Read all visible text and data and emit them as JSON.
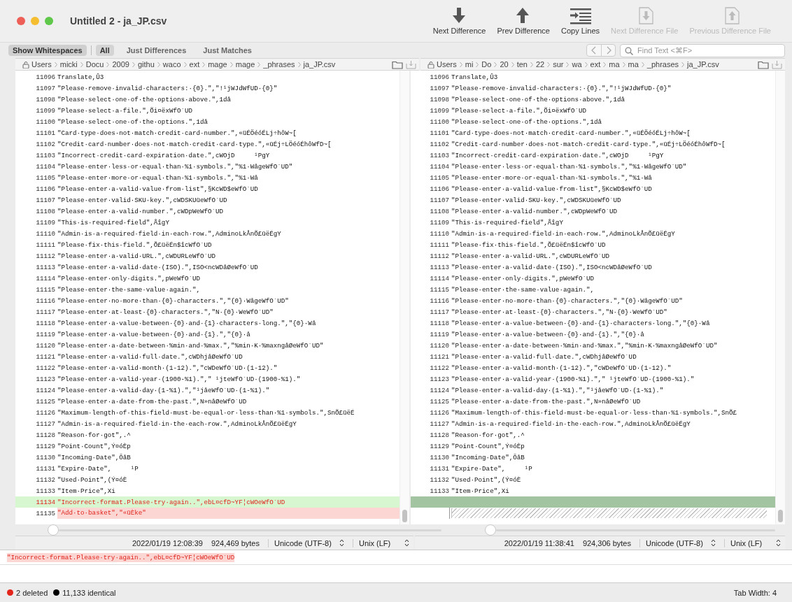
{
  "window": {
    "title": "Untitled 2 - ja_JP.csv"
  },
  "toolbar": [
    {
      "label": "Next Difference",
      "kind": "down",
      "disabled": false
    },
    {
      "label": "Prev Difference",
      "kind": "up",
      "disabled": false
    },
    {
      "label": "Copy Lines",
      "kind": "copy",
      "disabled": false
    },
    {
      "label": "Next Difference File",
      "kind": "file-down",
      "disabled": true
    },
    {
      "label": "Previous Difference File",
      "kind": "file-up",
      "disabled": true
    }
  ],
  "whitespace_toggle": {
    "label": "Show Whitespaces",
    "on": true
  },
  "filters": [
    {
      "label": "All",
      "selected": true
    },
    {
      "label": "Just Differences",
      "selected": false
    },
    {
      "label": "Just Matches",
      "selected": false
    }
  ],
  "search": {
    "placeholder": "Find Text <⌘F>"
  },
  "panes": [
    {
      "path": [
        "Users",
        "micki",
        "Docu",
        "2009",
        "githu",
        "waco",
        "ext",
        "mage",
        "mage",
        "_phrases",
        "ja_JP.csv"
      ],
      "lines": [
        {
          "number": "11096",
          "text": "Translate,Û3",
          "kind": "same"
        },
        {
          "number": "11097",
          "text": "\"Please·remove·invalid·characters:·{0}.\",\"!¹jWJdWfUD·{0}\"",
          "kind": "same"
        },
        {
          "number": "11098",
          "text": "\"Please·select·one·of·the·options·above.\",1då",
          "kind": "same"
        },
        {
          "number": "11099",
          "text": "\"Please·select·a·file.\",Õi¤ëxWfO`UD",
          "kind": "same"
        },
        {
          "number": "11100",
          "text": "\"Please·select·one·of·the·options.\",1då",
          "kind": "same"
        },
        {
          "number": "11101",
          "text": "\"Card·type·does·not·match·credit·card·number.\",«üÉÖéóÉLj÷hôW~[",
          "kind": "same"
        },
        {
          "number": "11102",
          "text": "\"Credit·card·number·does·not·match·credit·card·type.\",«üÉj÷LÖéóÉhôWfD~[",
          "kind": "same"
        },
        {
          "number": "11103",
          "text": "\"Incorrect·credit·card·expiration·date.\",cWOjD     ¹PgY",
          "kind": "same"
        },
        {
          "number": "11104",
          "text": "\"Please·enter·less·or·equal·than·%1·symbols.\",\"%1·WågeWfO`UD\"",
          "kind": "same"
        },
        {
          "number": "11105",
          "text": "\"Please·enter·more·or·equal·than·%1·symbols.\",\"%1·Wå",
          "kind": "same"
        },
        {
          "number": "11106",
          "text": "\"Please·enter·a·valid·value·from·list\",§KcWD$eWfO`UD",
          "kind": "same"
        },
        {
          "number": "11107",
          "text": "\"Please·enter·valid·SKU·key.\",cWDSKUüeWfO`UD",
          "kind": "same"
        },
        {
          "number": "11108",
          "text": "\"Please·enter·a·valid·number.\",cWDpWeWfO`UD",
          "kind": "same"
        },
        {
          "number": "11109",
          "text": "\"This·is·required·field\",ÅîgY",
          "kind": "same"
        },
        {
          "number": "11110",
          "text": "\"Admin·is·a·required·field·in·each·row.\",AdminoLkÅnÕ£üëÉgY",
          "kind": "same"
        },
        {
          "number": "11111",
          "text": "\"Please·fix·this·field.\",Õ£üëÉn$îcWfO`UD",
          "kind": "same"
        },
        {
          "number": "11112",
          "text": "\"Please·enter·a·valid·URL.\",cWDURLeWfO`UD",
          "kind": "same"
        },
        {
          "number": "11113",
          "text": "\"Please·enter·a·valid·date·(ISO).\",ISO<ncWDåØeWfO`UD",
          "kind": "same"
        },
        {
          "number": "11114",
          "text": "\"Please·enter·only·digits.\",pWeWfO`UD",
          "kind": "same"
        },
        {
          "number": "11115",
          "text": "\"Please·enter·the·same·value·again.\",",
          "kind": "same"
        },
        {
          "number": "11116",
          "text": "\"Please·enter·no·more·than·{0}·characters.\",\"{0}·WågeWfO`UD\"",
          "kind": "same"
        },
        {
          "number": "11117",
          "text": "\"Please·enter·at·least·{0}·characters.\",\"N·{0}·WeWfO`UD\"",
          "kind": "same"
        },
        {
          "number": "11118",
          "text": "\"Please·enter·a·value·between·{0}·and·{1}·characters·long.\",\"{0}·Wå",
          "kind": "same"
        },
        {
          "number": "11119",
          "text": "\"Please·enter·a·value·between·{0}·and·{1}.\",\"{0}·å",
          "kind": "same"
        },
        {
          "number": "11120",
          "text": "\"Please·enter·a·date·between·%min·and·%max.\",\"%min·K·%maxngåØeWfO`UD\"",
          "kind": "same"
        },
        {
          "number": "11121",
          "text": "\"Please·enter·a·valid·full·date.\",cWDhjåØeWfO`UD",
          "kind": "same"
        },
        {
          "number": "11122",
          "text": "\"Please·enter·a·valid·month·(1-12).\",\"cWDeWfO`UD·(1-12).\"",
          "kind": "same"
        },
        {
          "number": "11123",
          "text": "\"Please·enter·a·valid·year·(1900-%1).\",\" ¹jteWfO`UD·(1900-%1).\"",
          "kind": "same"
        },
        {
          "number": "11124",
          "text": "\"Please·enter·a·valid·day·(1-%1).\",\"¹jåeWfO`UD·(1-%1).\"",
          "kind": "same"
        },
        {
          "number": "11125",
          "text": "\"Please·enter·a·date·from·the·past.\",N»nåØeWfO`UD",
          "kind": "same"
        },
        {
          "number": "11126",
          "text": "\"Maximum·length·of·this·field·must·be·equal·or·less·than·%1·symbols.\",SnÕ£üëÉ",
          "kind": "same"
        },
        {
          "number": "11127",
          "text": "\"Admin·is·a·required·field·in·the·each·row.\",AdminoLkÅnÕ£üëÉgY",
          "kind": "same"
        },
        {
          "number": "11128",
          "text": "\"Reason·for·got\",.^",
          "kind": "same"
        },
        {
          "number": "11129",
          "text": "\"Point·Count\",Ý¤óÈp",
          "kind": "same"
        },
        {
          "number": "11130",
          "text": "\"Incoming·Date\",ÖåB",
          "kind": "same"
        },
        {
          "number": "11131",
          "text": "\"Expire·Date\",     ¹P",
          "kind": "same"
        },
        {
          "number": "11132",
          "text": "\"Used·Point\",(Ý¤óÈ",
          "kind": "same"
        },
        {
          "number": "11133",
          "text": "\"Item·Price\",Xi",
          "kind": "same"
        },
        {
          "number": "11134",
          "text": "\"Incorrect·format.Please·try·again..\",ebL¤cfD~YF¦cWOeWfO`UD",
          "kind": "current"
        },
        {
          "number": "11135",
          "text": "\"Add·to·basket\",\"«üÈke\"",
          "kind": "deleted"
        }
      ],
      "info": {
        "modified": "2022/01/19 12:08:39",
        "size": "924,469 bytes",
        "encoding": "Unicode (UTF-8)",
        "line_ending": "Unix (LF)"
      }
    },
    {
      "path": [
        "Users",
        "mi",
        "Do",
        "20",
        "ten",
        "22",
        "sur",
        "wa",
        "ext",
        "ma",
        "ma",
        "_phrases",
        "ja_JP.csv"
      ],
      "lines": [
        {
          "number": "11096",
          "text": "Translate,Û3",
          "kind": "same"
        },
        {
          "number": "11097",
          "text": "\"Please·remove·invalid·characters:·{0}.\",\"!¹jWJdWfUD·{0}\"",
          "kind": "same"
        },
        {
          "number": "11098",
          "text": "\"Please·select·one·of·the·options·above.\",1då",
          "kind": "same"
        },
        {
          "number": "11099",
          "text": "\"Please·select·a·file.\",Õi¤ëxWfO`UD",
          "kind": "same"
        },
        {
          "number": "11100",
          "text": "\"Please·select·one·of·the·options.\",1då",
          "kind": "same"
        },
        {
          "number": "11101",
          "text": "\"Card·type·does·not·match·credit·card·number.\",«üÉÖéóÉLj÷hôW~[",
          "kind": "same"
        },
        {
          "number": "11102",
          "text": "\"Credit·card·number·does·not·match·credit·card·type.\",«üÉj÷LÖéóÉhôWfD~[",
          "kind": "same"
        },
        {
          "number": "11103",
          "text": "\"Incorrect·credit·card·expiration·date.\",cWOjD     ¹PgY",
          "kind": "same"
        },
        {
          "number": "11104",
          "text": "\"Please·enter·less·or·equal·than·%1·symbols.\",\"%1·WågeWfO`UD\"",
          "kind": "same"
        },
        {
          "number": "11105",
          "text": "\"Please·enter·more·or·equal·than·%1·symbols.\",\"%1·Wå",
          "kind": "same"
        },
        {
          "number": "11106",
          "text": "\"Please·enter·a·valid·value·from·list\",§KcWD$eWfO`UD",
          "kind": "same"
        },
        {
          "number": "11107",
          "text": "\"Please·enter·valid·SKU·key.\",cWDSKUüeWfO`UD",
          "kind": "same"
        },
        {
          "number": "11108",
          "text": "\"Please·enter·a·valid·number.\",cWDpWeWfO`UD",
          "kind": "same"
        },
        {
          "number": "11109",
          "text": "\"This·is·required·field\",ÅîgY",
          "kind": "same"
        },
        {
          "number": "11110",
          "text": "\"Admin·is·a·required·field·in·each·row.\",AdminoLkÅnÕ£üëÉgY",
          "kind": "same"
        },
        {
          "number": "11111",
          "text": "\"Please·fix·this·field.\",Õ£üëÉn$îcWfO`UD",
          "kind": "same"
        },
        {
          "number": "11112",
          "text": "\"Please·enter·a·valid·URL.\",cWDURLeWfO`UD",
          "kind": "same"
        },
        {
          "number": "11113",
          "text": "\"Please·enter·a·valid·date·(ISO).\",ISO<ncWDåØeWfO`UD",
          "kind": "same"
        },
        {
          "number": "11114",
          "text": "\"Please·enter·only·digits.\",pWeWfO`UD",
          "kind": "same"
        },
        {
          "number": "11115",
          "text": "\"Please·enter·the·same·value·again.\",",
          "kind": "same"
        },
        {
          "number": "11116",
          "text": "\"Please·enter·no·more·than·{0}·characters.\",\"{0}·WågeWfO`UD\"",
          "kind": "same"
        },
        {
          "number": "11117",
          "text": "\"Please·enter·at·least·{0}·characters.\",\"N·{0}·WeWfO`UD\"",
          "kind": "same"
        },
        {
          "number": "11118",
          "text": "\"Please·enter·a·value·between·{0}·and·{1}·characters·long.\",\"{0}·Wå",
          "kind": "same"
        },
        {
          "number": "11119",
          "text": "\"Please·enter·a·value·between·{0}·and·{1}.\",\"{0}·å",
          "kind": "same"
        },
        {
          "number": "11120",
          "text": "\"Please·enter·a·date·between·%min·and·%max.\",\"%min·K·%maxngåØeWfO`UD\"",
          "kind": "same"
        },
        {
          "number": "11121",
          "text": "\"Please·enter·a·valid·full·date.\",cWDhjåØeWfO`UD",
          "kind": "same"
        },
        {
          "number": "11122",
          "text": "\"Please·enter·a·valid·month·(1-12).\",\"cWDeWfO`UD·(1-12).\"",
          "kind": "same"
        },
        {
          "number": "11123",
          "text": "\"Please·enter·a·valid·year·(1900-%1).\",\" ¹jteWfO`UD·(1900-%1).\"",
          "kind": "same"
        },
        {
          "number": "11124",
          "text": "\"Please·enter·a·valid·day·(1-%1).\",\"¹jåeWfO`UD·(1-%1).\"",
          "kind": "same"
        },
        {
          "number": "11125",
          "text": "\"Please·enter·a·date·from·the·past.\",N»nåØeWfO`UD",
          "kind": "same"
        },
        {
          "number": "11126",
          "text": "\"Maximum·length·of·this·field·must·be·equal·or·less·than·%1·symbols.\",SnÕ£",
          "kind": "same"
        },
        {
          "number": "11127",
          "text": "\"Admin·is·a·required·field·in·the·each·row.\",AdminoLkÅnÕ£üëÉgY",
          "kind": "same"
        },
        {
          "number": "11128",
          "text": "\"Reason·for·got\",.^",
          "kind": "same"
        },
        {
          "number": "11129",
          "text": "\"Point·Count\",Ý¤óÈp",
          "kind": "same"
        },
        {
          "number": "11130",
          "text": "\"Incoming·Date\",ÖåB",
          "kind": "same"
        },
        {
          "number": "11131",
          "text": "\"Expire·Date\",     ¹P",
          "kind": "same"
        },
        {
          "number": "11132",
          "text": "\"Used·Point\",(Ý¤óÈ",
          "kind": "same"
        },
        {
          "number": "11133",
          "text": "\"Item·Price\",Xi",
          "kind": "same"
        },
        {
          "kind": "gap-current"
        },
        {
          "kind": "gap"
        }
      ],
      "info": {
        "modified": "2022/01/19 11:38:41",
        "size": "924,306 bytes",
        "encoding": "Unicode (UTF-8)",
        "line_ending": "Unix (LF)"
      }
    }
  ],
  "detail": "\"Incorrect·format.Please·try·again..\",ebL¤cfD~YF¦cWOeWfO`UD",
  "status_bar": {
    "counts": [
      {
        "label": "2 deleted",
        "color": "#e3241b"
      },
      {
        "label": "11,133 identical",
        "color": "#000000"
      }
    ],
    "tab_width": "Tab Width: 4"
  }
}
